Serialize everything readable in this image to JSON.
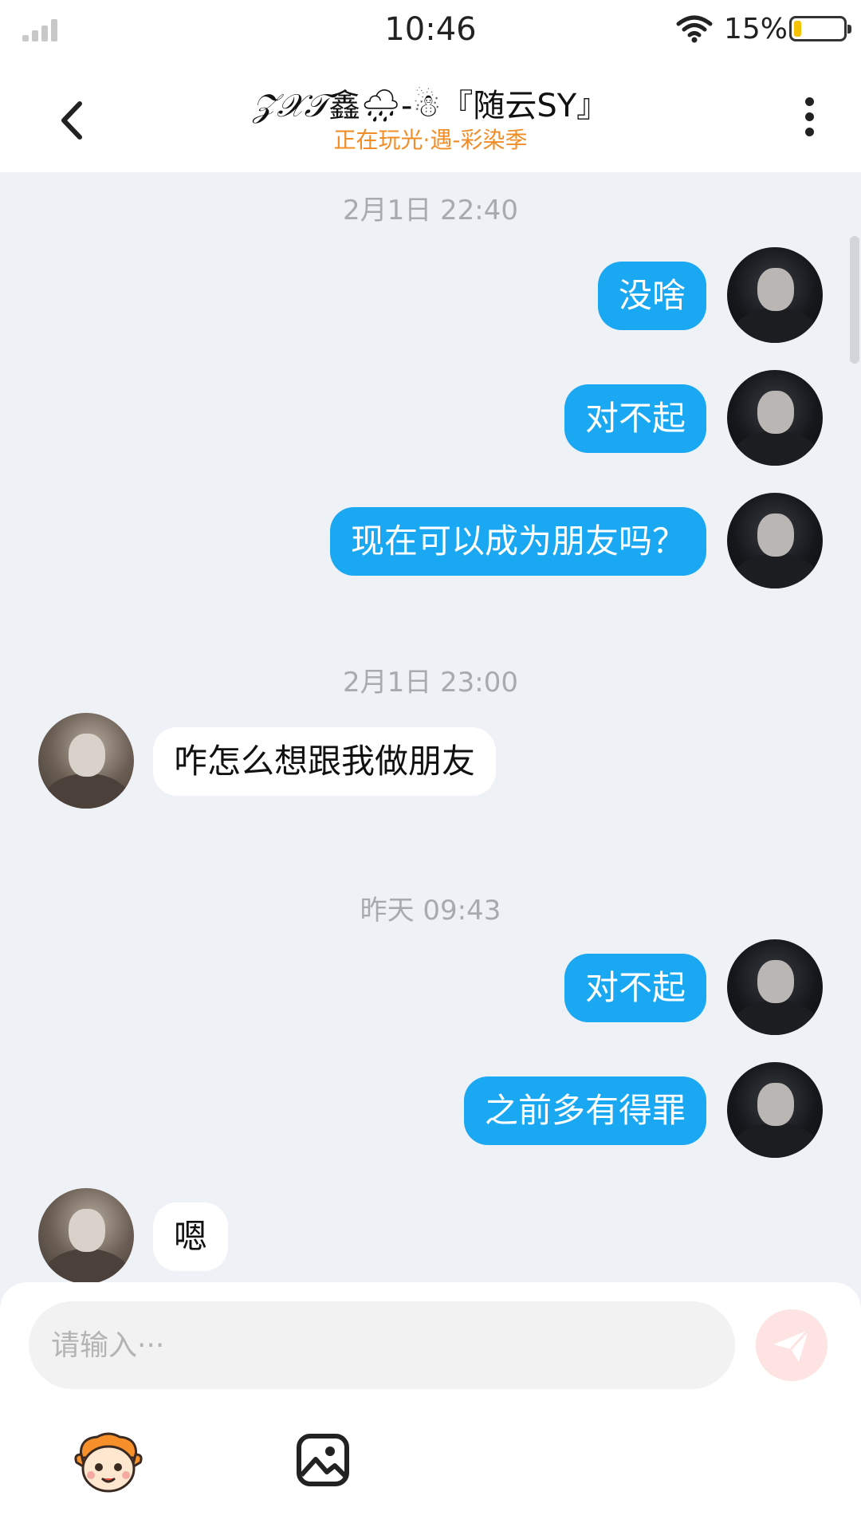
{
  "status_bar": {
    "time": "10:46",
    "battery_percent": "15%",
    "battery_level": 0.15
  },
  "header": {
    "title_deco": "𝒵𝒳𝒯",
    "title": "鑫🌧-☃『随云SY』",
    "subtitle": "正在玩光·遇-彩染季"
  },
  "messages": [
    {
      "type": "timestamp",
      "text": "2月1日 22:40"
    },
    {
      "type": "message",
      "side": "me",
      "text": "没啥"
    },
    {
      "type": "message",
      "side": "me",
      "text": "对不起"
    },
    {
      "type": "message",
      "side": "me",
      "text": "现在可以成为朋友吗？"
    },
    {
      "type": "timestamp",
      "text": "2月1日 23:00"
    },
    {
      "type": "message",
      "side": "them",
      "text": "咋怎么想跟我做朋友"
    },
    {
      "type": "timestamp",
      "text": "昨天 09:43"
    },
    {
      "type": "message",
      "side": "me",
      "text": "对不起"
    },
    {
      "type": "message",
      "side": "me",
      "text": "之前多有得罪"
    },
    {
      "type": "message",
      "side": "them",
      "text": "嗯"
    }
  ],
  "input": {
    "placeholder": "请输入···",
    "value": ""
  },
  "icons": {
    "back": "chevron-left-icon",
    "more": "more-vertical-icon",
    "send": "send-icon",
    "emoji": "mascot-emoji-icon",
    "image": "image-icon"
  },
  "colors": {
    "my_bubble": "#1aa8f3",
    "their_bubble": "#ffffff",
    "subtitle": "#f08d26",
    "background": "#eef1f6",
    "send_button": "#fde3e1"
  }
}
